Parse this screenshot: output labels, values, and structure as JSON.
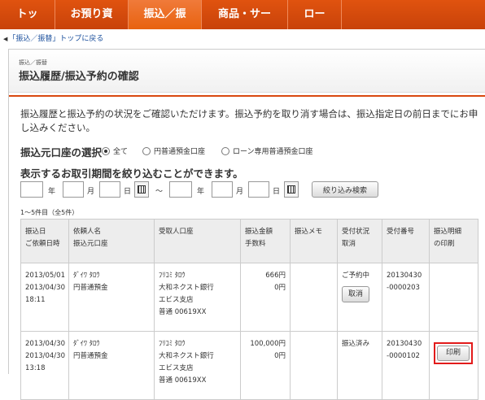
{
  "nav": [
    "トップ",
    "お預り資産",
    "振込／振替",
    "商品・サービス",
    "ローン"
  ],
  "backlink": "「振込／振替」トップに戻る",
  "header": {
    "crumb": "振込／振替",
    "title": "振込履歴/振込予約の確認"
  },
  "description": "振込履歴と振込予約の状況をご確認いただけます。振込予約を取り消す場合は、振込指定日の前日までにお申し込みください。",
  "account_select": {
    "label": "振込元口座の選択",
    "options": [
      "全て",
      "円普通預金口座",
      "ローン専用普通預金口座"
    ],
    "selected": 0
  },
  "period": {
    "label": "表示するお取引期間を絞り込むことができます。",
    "year": "年",
    "month": "月",
    "day": "日",
    "tilde": "～",
    "search_button": "絞り込み検索"
  },
  "result_count": "1～5件目（全5件）",
  "table": {
    "headers": [
      [
        "振込日",
        "ご依頼日時"
      ],
      [
        "依頼人名",
        "振込元口座"
      ],
      [
        "受取人口座"
      ],
      [
        "振込金額",
        "手数料"
      ],
      [
        "振込メモ"
      ],
      [
        "受付状況",
        "取消"
      ],
      [
        "受付番号"
      ],
      [
        "振込明細",
        "の印刷"
      ]
    ],
    "rows": [
      {
        "dates": [
          "2013/05/01",
          "2013/04/30",
          "18:11"
        ],
        "requester": [
          "ﾀﾞｲﾜ ﾀﾛｳ",
          "円普通預金"
        ],
        "payee": [
          "ﾌﾘｺﾐ ﾀﾛｳ",
          "大和ネクスト銀行",
          "エビス支店",
          "普通 00619XX"
        ],
        "amount": [
          "666円",
          "0円"
        ],
        "memo": "",
        "status": "ご予約中",
        "cancel_button": "取消",
        "receipt": [
          "20130430",
          "-0000203"
        ]
      },
      {
        "dates": [
          "2013/04/30",
          "2013/04/30",
          "13:18"
        ],
        "requester": [
          "ﾀﾞｲﾜ ﾀﾛｳ",
          "円普通預金"
        ],
        "payee": [
          "ﾌﾘｺﾐ ﾀﾛｳ",
          "大和ネクスト銀行",
          "エビス支店",
          "普通 00619XX"
        ],
        "amount": [
          "100,000円",
          "0円"
        ],
        "memo": "",
        "status": "振込済み",
        "receipt": [
          "20130430",
          "-0000102"
        ],
        "print_button": "印刷"
      }
    ]
  }
}
